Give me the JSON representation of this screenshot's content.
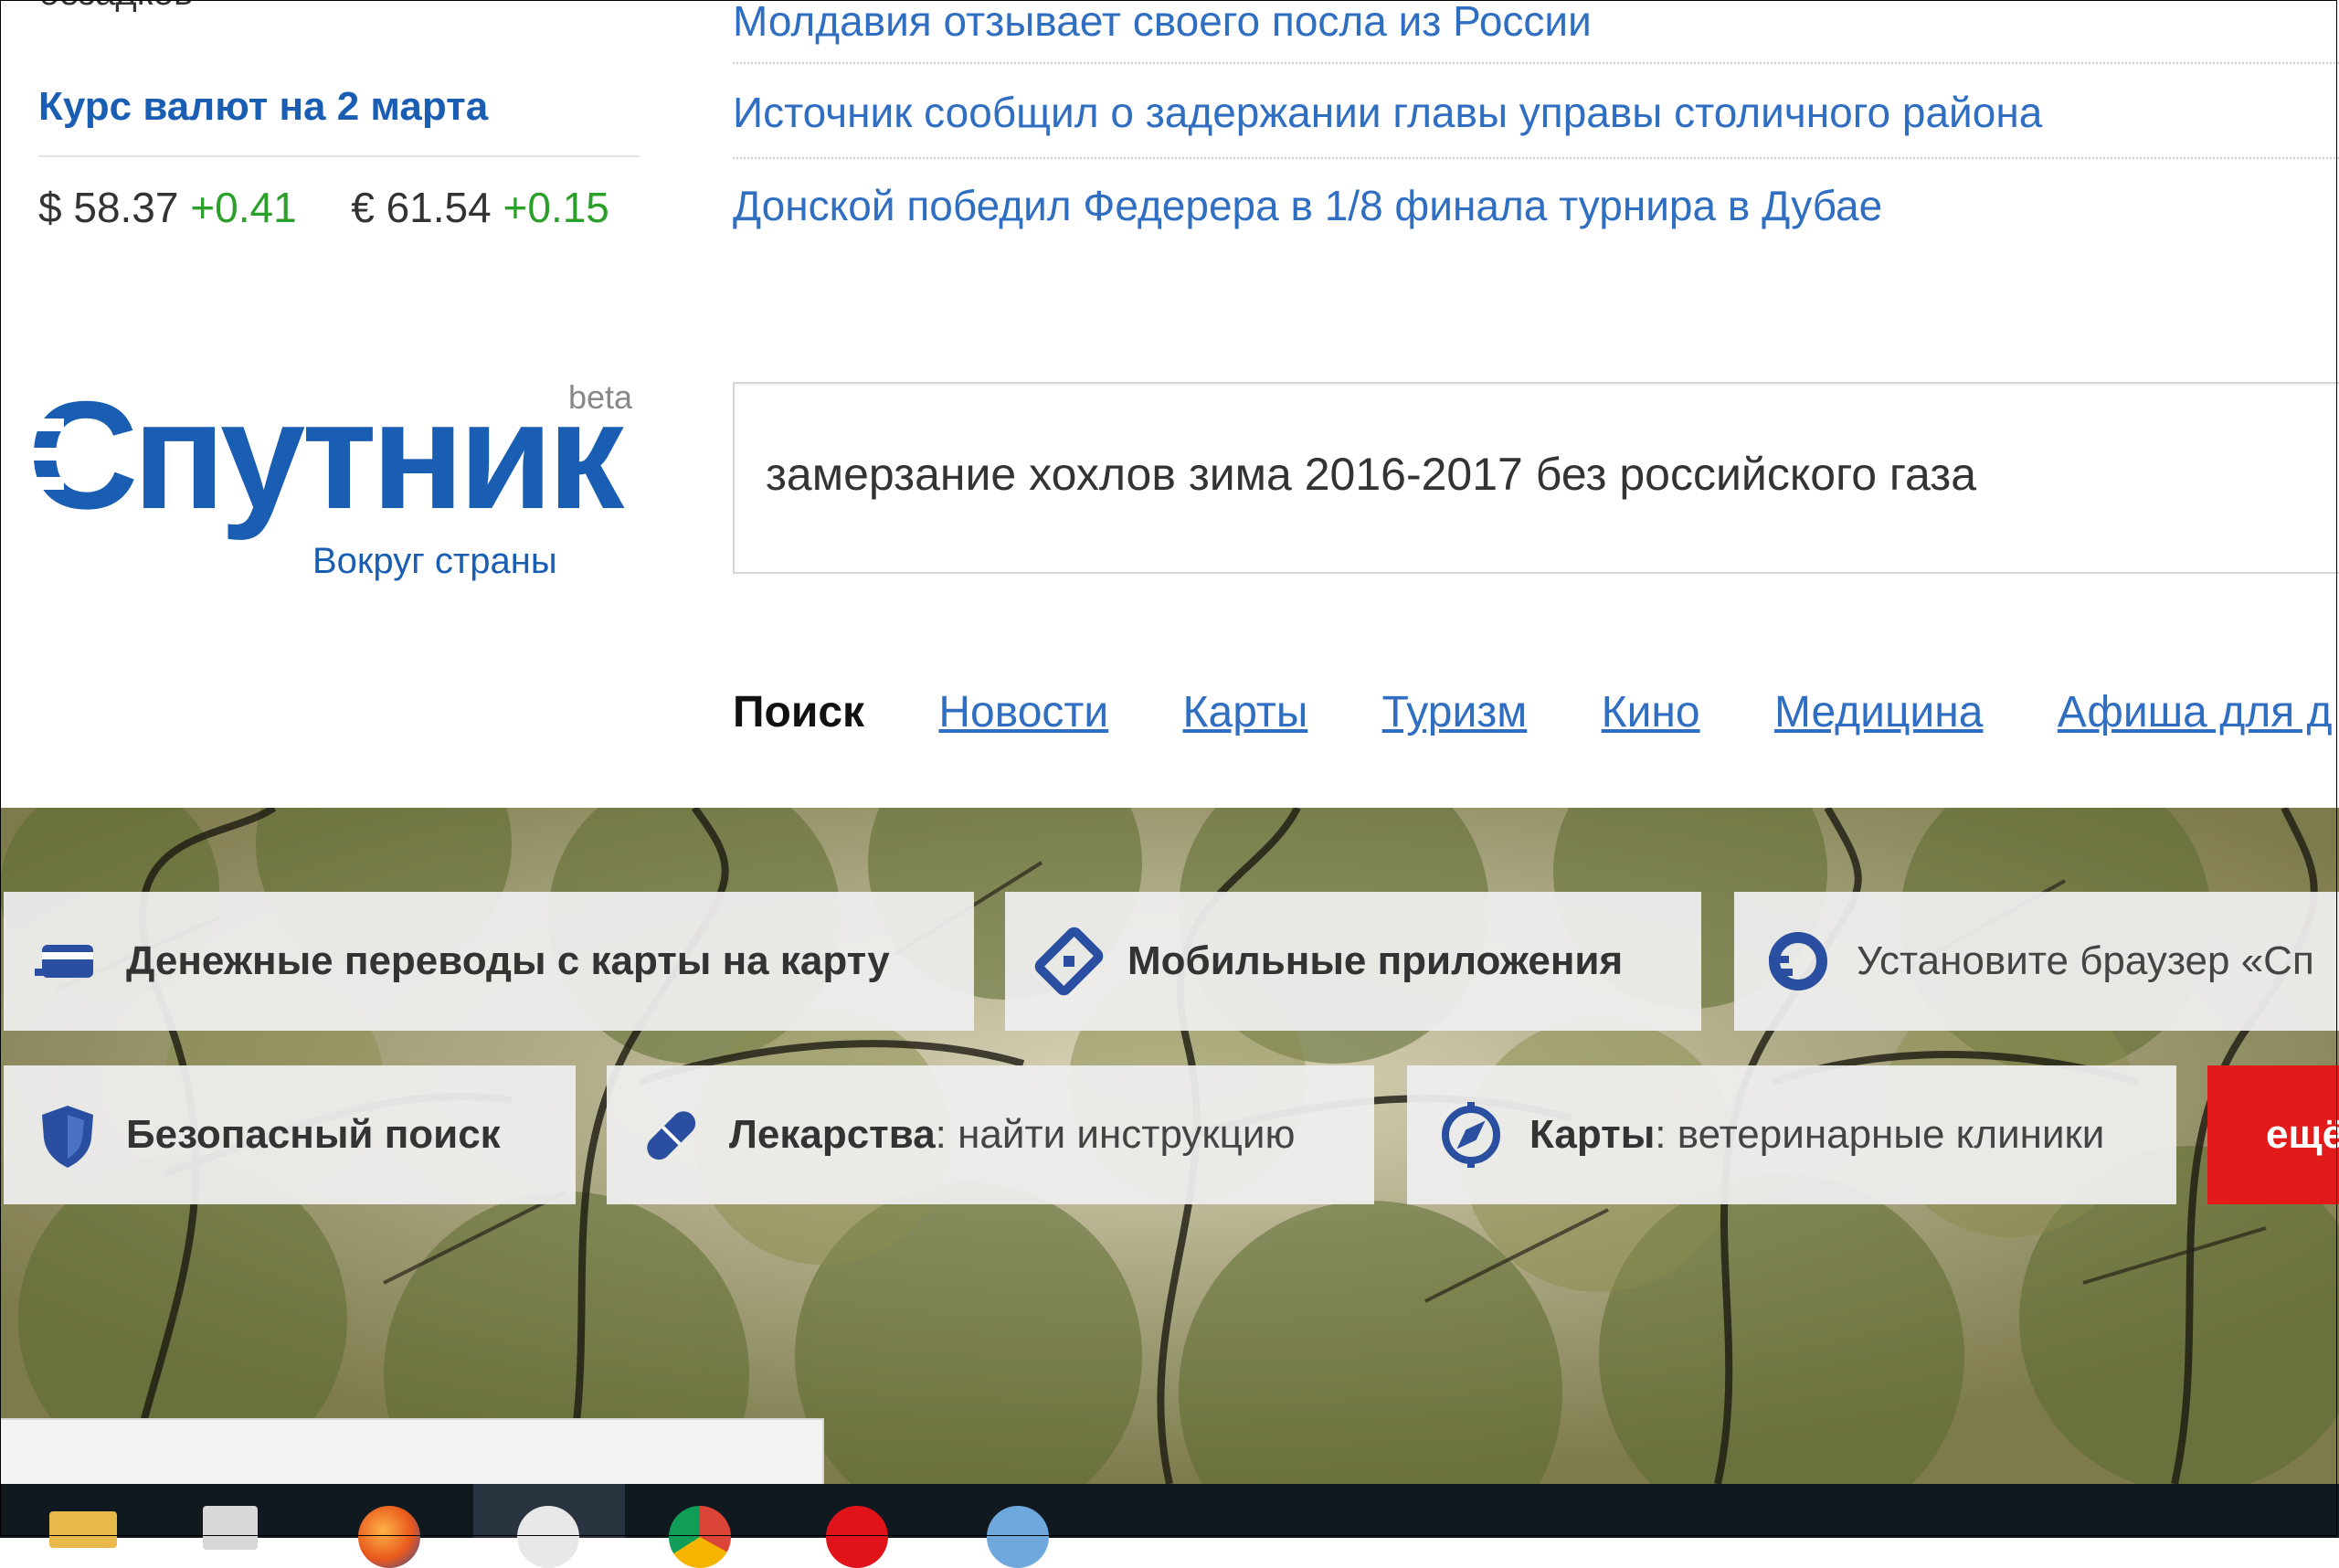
{
  "top_cut_text": "безадков",
  "rates": {
    "title": "Курс валют на 2 марта",
    "usd_value": "$ 58.37",
    "usd_change": "+0.41",
    "eur_value": "€ 61.54",
    "eur_change": "+0.15"
  },
  "news": [
    "Молдавия отзывает своего посла из России",
    "Источник сообщил о задержании главы управы столичного района",
    "Донской победил Федерера в 1/8 финала турнира в Дубае"
  ],
  "logo": {
    "name": "Спутник",
    "badge": "beta",
    "subtitle": "Вокруг страны"
  },
  "search": {
    "value": "замерзание хохлов зима 2016-2017 без российского газа"
  },
  "nav": {
    "current": "Поиск",
    "links": [
      "Новости",
      "Карты",
      "Туризм",
      "Кино",
      "Медицина",
      "Афиша для д"
    ]
  },
  "tiles": {
    "row1": [
      {
        "icon": "card-transfer-icon",
        "bold": "Денежные переводы с карты на карту",
        "rest": ""
      },
      {
        "icon": "mobile-apps-icon",
        "bold": "Мобильные приложения",
        "rest": ""
      },
      {
        "icon": "browser-icon",
        "bold": "",
        "rest": "Установите браузер «Сп"
      }
    ],
    "row2": [
      {
        "icon": "shield-icon",
        "bold": "Безопасный поиск",
        "rest": ""
      },
      {
        "icon": "pill-icon",
        "bold": "Лекарства",
        "rest": ": найти инструкцию"
      },
      {
        "icon": "compass-icon",
        "bold": "Карты",
        "rest": ": ветеринарные клиники"
      }
    ],
    "more_label": "ещё"
  },
  "colors": {
    "brand_blue": "#1a5eb3",
    "link_blue": "#2f6ec0",
    "positive_green": "#2aa02a",
    "more_red": "#e31a1a"
  },
  "taskbar": {
    "icons": [
      "file-explorer-icon",
      "store-icon",
      "firefox-icon",
      "mail-icon",
      "chrome-icon",
      "opera-icon",
      "app-icon"
    ]
  }
}
